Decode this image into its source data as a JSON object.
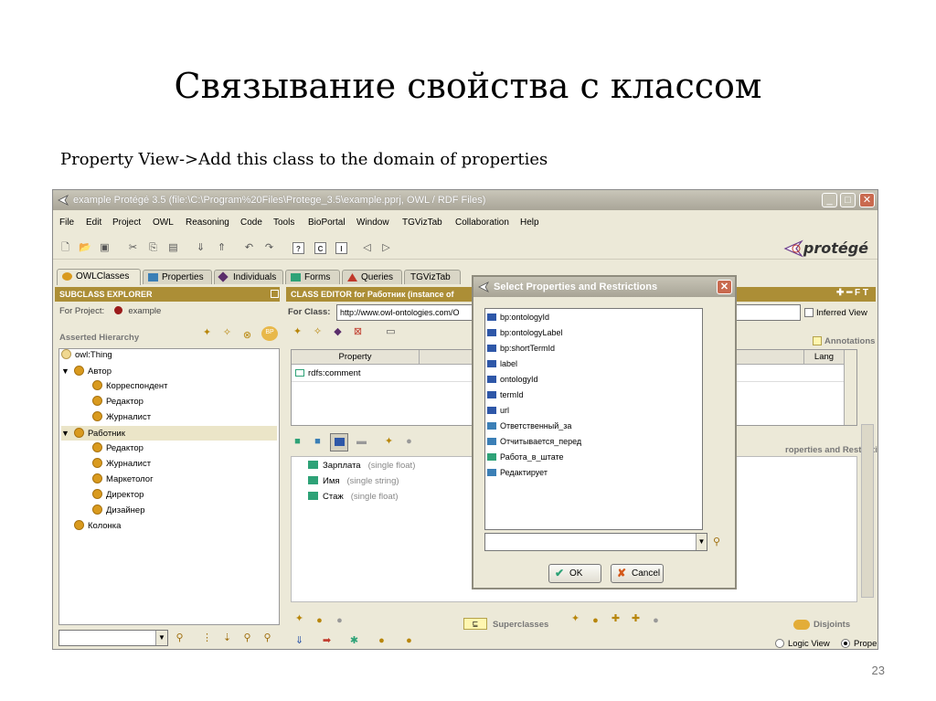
{
  "slide": {
    "title": "Связывание свойства с классом",
    "subtitle": "Property View->Add this class to the domain of properties",
    "page_number": "23"
  },
  "window": {
    "title": "example  Protégé 3.5     (file:\\C:\\Program%20Files\\Protege_3.5\\example.pprj, OWL / RDF Files)",
    "brand": "protégé"
  },
  "menu": [
    "File",
    "Edit",
    "Project",
    "OWL",
    "Reasoning",
    "Code",
    "Tools",
    "BioPortal",
    "Window",
    "TGVizTab",
    "Collaboration",
    "Help"
  ],
  "tabs": [
    {
      "label": "OWLClasses",
      "icon": "owl-class-icon"
    },
    {
      "label": "Properties",
      "icon": "properties-icon"
    },
    {
      "label": "Individuals",
      "icon": "individuals-icon"
    },
    {
      "label": "Forms",
      "icon": "forms-icon"
    },
    {
      "label": "Queries",
      "icon": "queries-icon"
    },
    {
      "label": "TGVizTab",
      "icon": ""
    }
  ],
  "subclass_explorer": {
    "header": "SUBCLASS EXPLORER",
    "for_project_label": "For Project:",
    "project_name": "example",
    "hierarchy_label": "Asserted Hierarchy",
    "tree": [
      {
        "label": "owl:Thing",
        "level": 0,
        "arrow": ""
      },
      {
        "label": "Автор",
        "level": 1,
        "arrow": "▼"
      },
      {
        "label": "Корреспондент",
        "level": 2,
        "arrow": ""
      },
      {
        "label": "Редактор",
        "level": 2,
        "arrow": ""
      },
      {
        "label": "Журналист",
        "level": 2,
        "arrow": ""
      },
      {
        "label": "Работник",
        "level": 1,
        "arrow": "▼",
        "selected": true
      },
      {
        "label": "Редактор",
        "level": 2,
        "arrow": ""
      },
      {
        "label": "Журналист",
        "level": 2,
        "arrow": ""
      },
      {
        "label": "Маркетолог",
        "level": 2,
        "arrow": ""
      },
      {
        "label": "Директор",
        "level": 2,
        "arrow": ""
      },
      {
        "label": "Дизайнер",
        "level": 2,
        "arrow": ""
      },
      {
        "label": "Колонка",
        "level": 1,
        "arrow": ""
      }
    ]
  },
  "class_editor": {
    "header": "CLASS EDITOR for Работник  (instance of",
    "for_class_label": "For Class:",
    "for_class_value": "http://www.owl-ontologies.com/O",
    "inferred_view": "Inferred View",
    "annotations_label": "Annotations",
    "property_col": "Property",
    "lang_col": "Lang",
    "annotation_row": "rdfs:comment",
    "props_restrictions_label": "roperties and Restrictions",
    "properties": [
      {
        "name": "Зарплата",
        "hint": "(single float)"
      },
      {
        "name": "Имя",
        "hint": "(single string)"
      },
      {
        "name": "Стаж",
        "hint": "(single float)"
      }
    ],
    "superclasses_label": "Superclasses",
    "disjoints_label": "Disjoints",
    "logic_view": "Logic View",
    "properties_view": "Properties View"
  },
  "dialog": {
    "title": "Select Properties and Restrictions",
    "items": [
      {
        "label": "bp:ontologyId",
        "color": "#2e57a8"
      },
      {
        "label": "bp:ontologyLabel",
        "color": "#2e57a8"
      },
      {
        "label": "bp:shortTermId",
        "color": "#2e57a8"
      },
      {
        "label": "label",
        "color": "#2e57a8"
      },
      {
        "label": "ontologyId",
        "color": "#2e57a8"
      },
      {
        "label": "termId",
        "color": "#2e57a8"
      },
      {
        "label": "url",
        "color": "#2e57a8"
      },
      {
        "label": "Ответственный_за",
        "color": "#3b7fb6"
      },
      {
        "label": "Отчитывается_перед",
        "color": "#3b7fb6"
      },
      {
        "label": "Работа_в_штате",
        "color": "#2ea277"
      },
      {
        "label": "Редактирует",
        "color": "#3b7fb6"
      }
    ],
    "ok_label": "OK",
    "cancel_label": "Cancel"
  },
  "colors": {
    "header_gold": "#ac8e36",
    "class_dot": "#d99a1e",
    "datatype_prop": "#2ea277",
    "object_prop": "#2e57a8"
  }
}
